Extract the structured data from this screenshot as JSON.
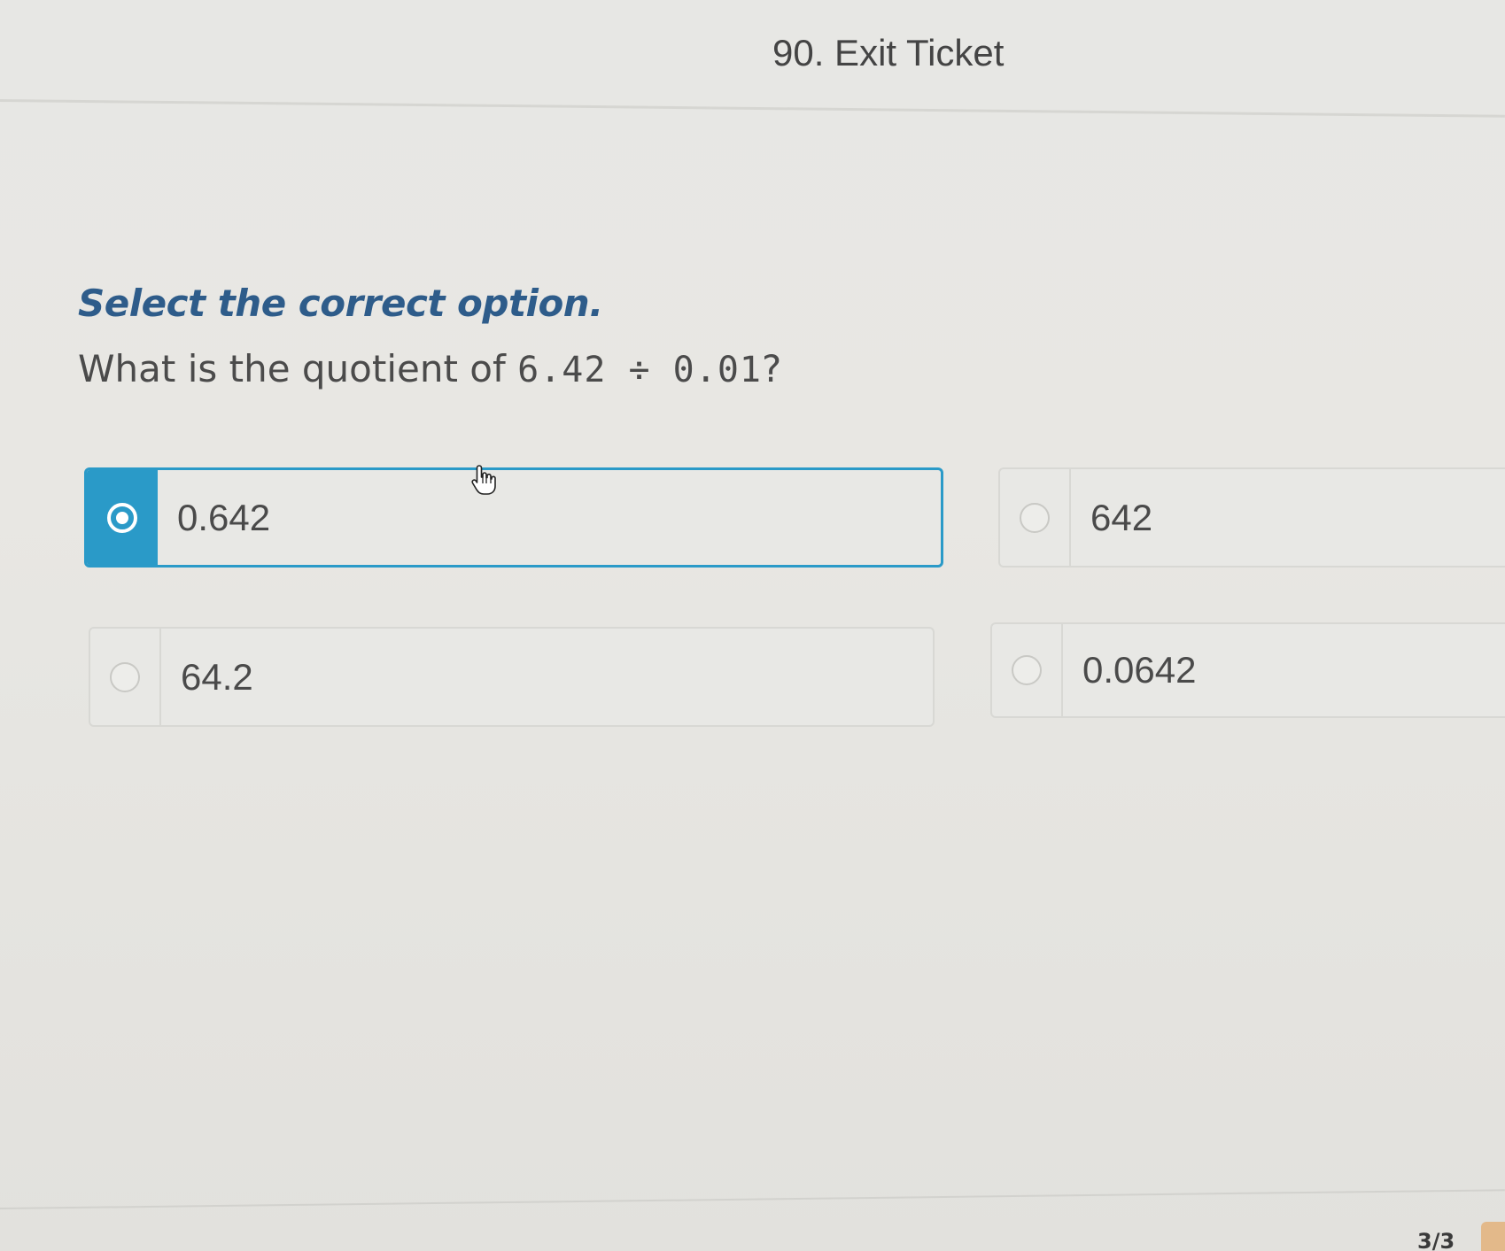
{
  "header": {
    "title": "90. Exit Ticket"
  },
  "question": {
    "instruction": "Select the correct option.",
    "prompt_prefix": "What is the quotient of ",
    "expression": "6.42 ÷ 0.01",
    "prompt_suffix": "?"
  },
  "options": [
    {
      "label": "0.642",
      "selected": true
    },
    {
      "label": "642",
      "selected": false
    },
    {
      "label": "64.2",
      "selected": false
    },
    {
      "label": "0.0642",
      "selected": false
    }
  ],
  "footer": {
    "page_counter": "3/3"
  },
  "colors": {
    "accent": "#2a9ac8",
    "instruction": "#2e5c8a",
    "background": "#e8e8e5"
  },
  "icons": {
    "cursor": "hand-pointer-icon",
    "radio_selected": "radio-selected-icon",
    "radio_unselected": "radio-unselected-icon"
  }
}
